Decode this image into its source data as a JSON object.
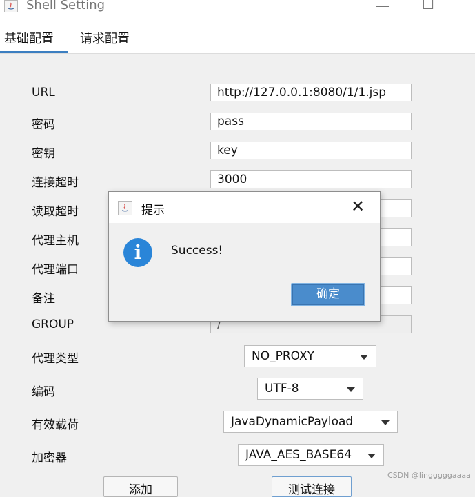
{
  "window": {
    "title": "Shell Setting",
    "minimize_glyph": "—",
    "maximize_glyph": "☐"
  },
  "tabs": [
    {
      "label": "基础配置",
      "active": true
    },
    {
      "label": "请求配置",
      "active": false
    }
  ],
  "form": {
    "url_label": "URL",
    "url_value": "http://127.0.0.1:8080/1/1.jsp",
    "password_label": "密码",
    "password_value": "pass",
    "key_label": "密钥",
    "key_value": "key",
    "conn_timeout_label": "连接超时",
    "conn_timeout_value": "3000",
    "read_timeout_label": "读取超时",
    "proxy_host_label": "代理主机",
    "proxy_port_label": "代理端口",
    "remark_label": "备注",
    "group_label": "GROUP",
    "group_value": "/",
    "proxy_type_label": "代理类型",
    "proxy_type_value": "NO_PROXY",
    "encoding_label": "编码",
    "encoding_value": "UTF-8",
    "payload_label": "有效载荷",
    "payload_value": "JavaDynamicPayload",
    "cryption_label": "加密器",
    "cryption_value": "JAVA_AES_BASE64"
  },
  "buttons": {
    "add_label": "添加",
    "test_label": "测试连接"
  },
  "dialog": {
    "title": "提示",
    "close_glyph": "✕",
    "info_glyph": "i",
    "message": "Success!",
    "ok_label": "确定"
  },
  "watermark": "CSDN @lingggggaaaa",
  "colors": {
    "accent": "#3c7fc1",
    "info_icon": "#2a85d8",
    "ok_button": "#4a8ccc"
  },
  "icons": [
    "java-app-icon",
    "info-icon",
    "close-icon",
    "dropdown-arrow-icon"
  ]
}
